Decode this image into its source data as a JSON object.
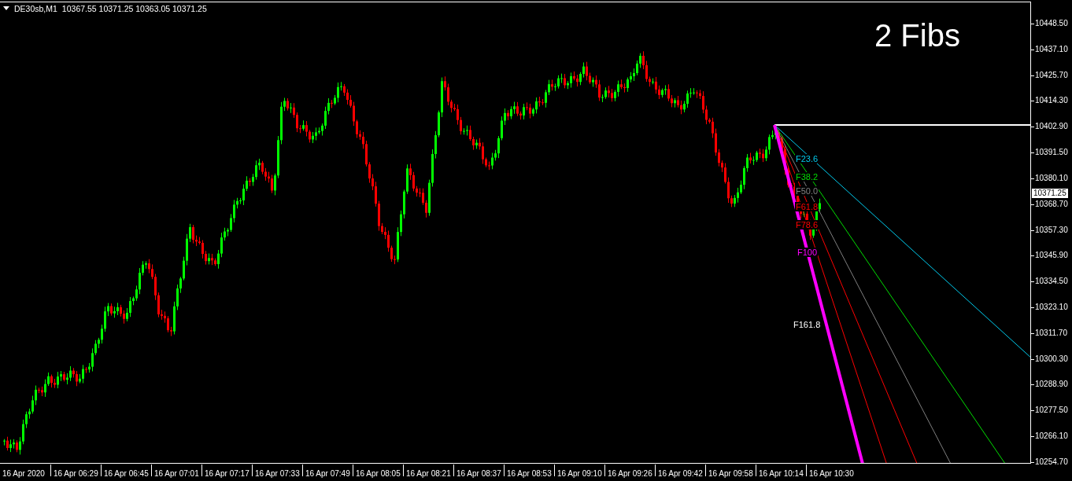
{
  "chart": {
    "symbol": "DE30sb,M1",
    "ohlc": "10367.55 10371.25 10363.05 10371.25",
    "overlay_title": "2 Fibs",
    "fib_levels": [
      {
        "label": "F23.6",
        "color": "#00ccee"
      },
      {
        "label": "F38.2",
        "color": "#00dd00"
      },
      {
        "label": "F50.0",
        "color": "#808080"
      },
      {
        "label": "F61.8",
        "color": "#ff0000"
      },
      {
        "label": "F78.6",
        "color": "#ff0000"
      },
      {
        "label": "F100",
        "color": "#ff00ff"
      },
      {
        "label": "F161.8"
      }
    ],
    "current_price": "10371.25",
    "price_axis": [
      "10448.50",
      "10437.10",
      "10425.70",
      "10414.30",
      "10402.90",
      "10391.50",
      "10380.10",
      "10368.70",
      "10357.30",
      "10345.90",
      "10334.50",
      "10323.10",
      "10311.70",
      "10300.30",
      "10288.90",
      "10277.50",
      "10266.10",
      "10254.70"
    ],
    "time_axis": [
      "16 Apr 2020",
      "16 Apr 06:29",
      "16 Apr 06:45",
      "16 Apr 07:01",
      "16 Apr 07:17",
      "16 Apr 07:33",
      "16 Apr 07:49",
      "16 Apr 08:05",
      "16 Apr 08:21",
      "16 Apr 08:37",
      "16 Apr 08:53",
      "16 Apr 09:10",
      "16 Apr 09:26",
      "16 Apr 09:42",
      "16 Apr 09:58",
      "16 Apr 10:14",
      "16 Apr 10:30"
    ]
  }
}
